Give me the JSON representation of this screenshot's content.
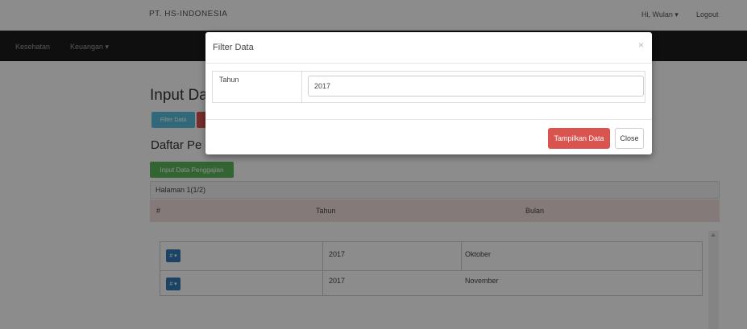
{
  "header": {
    "brand": "PT. HS-INDONESIA",
    "greeting": "Hi, Wulan ▾",
    "logout": "Logout"
  },
  "navbar": {
    "items": [
      {
        "label": "Kesehatan"
      },
      {
        "label": "Keuangan ▾"
      }
    ]
  },
  "page": {
    "title": "Input Da",
    "filter_button": "Filter Data",
    "subtitle": "Daftar Pe",
    "input_button": "Input Data Penggajian",
    "pagination": "Halaman 1(1/2)",
    "table_headers": [
      "#",
      "Tahun",
      "Bulan"
    ],
    "rows": [
      {
        "action": "# ▾",
        "tahun": "2017",
        "bulan": "Oktober"
      },
      {
        "action": "# ▾",
        "tahun": "2017",
        "bulan": "November"
      }
    ]
  },
  "modal": {
    "title": "Filter Data",
    "close_icon": "×",
    "field_label": "Tahun",
    "field_value": "2017",
    "submit_label": "Tampilkan Data",
    "close_label": "Close"
  },
  "colors": {
    "navbar": "#1c1c1c",
    "overlay": "rgba(0,0,0,0.45)",
    "danger": "#d9534f",
    "info": "#5bc0de",
    "success": "#5cb85c",
    "primary": "#337ab7",
    "table_header": "#f2dede"
  }
}
